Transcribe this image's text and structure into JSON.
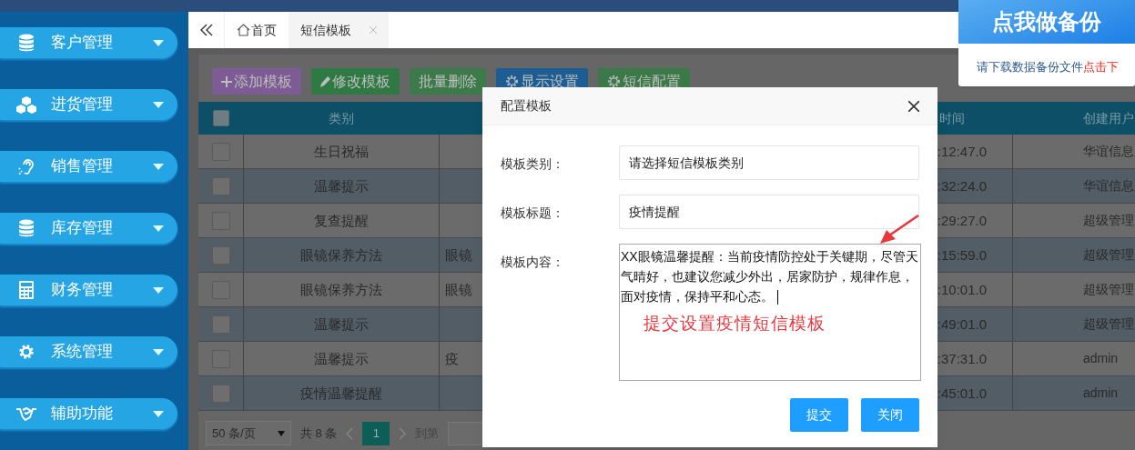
{
  "sidebar": {
    "items": [
      {
        "label": "客户管理"
      },
      {
        "label": "进货管理"
      },
      {
        "label": "销售管理"
      },
      {
        "label": "库存管理"
      },
      {
        "label": "财务管理"
      },
      {
        "label": "系统管理"
      },
      {
        "label": "辅助功能"
      }
    ]
  },
  "tabs": [
    {
      "label": "首页",
      "selected": false
    },
    {
      "label": "短信模板",
      "selected": true
    }
  ],
  "toolbar": [
    {
      "label": "添加模板",
      "color": "#7d5b94"
    },
    {
      "label": "修改模板",
      "color": "#2f7a44"
    },
    {
      "label": "批量删除",
      "color": "#3d7a4b"
    },
    {
      "label": "显示设置",
      "color": "#1c5e94"
    },
    {
      "label": "短信配置",
      "color": "#3b7a48"
    }
  ],
  "table": {
    "columns": [
      "类别",
      "时间",
      "创建用户"
    ],
    "all_checked": false,
    "rows": [
      {
        "checked": false,
        "category": "生日祝福",
        "time": ":12:47.0",
        "creator": "华谊信息"
      },
      {
        "checked": false,
        "category": "温馨提示",
        "time": ":32:24.0",
        "creator": "华谊信息"
      },
      {
        "checked": false,
        "category": "复查提醒",
        "time": ":29:27.0",
        "creator": "超级管理"
      },
      {
        "checked": false,
        "category": "眼镜保养方法",
        "column_3": "眼镜",
        "time": ":15:59.0",
        "creator": "超级管理"
      },
      {
        "checked": false,
        "category": "眼镜保养方法",
        "column_3": "眼镜",
        "time": ":10:01.0",
        "creator": "超级管理"
      },
      {
        "checked": false,
        "category": "温馨提示",
        "time": ":49:01.0",
        "creator": "超级管理"
      },
      {
        "checked": false,
        "category": "温馨提示",
        "column_3": "疫",
        "time": ":37:31.0",
        "creator": "admin"
      },
      {
        "checked": false,
        "category": "疫情温馨提醒",
        "time": ":45:01.0",
        "creator": "admin"
      }
    ]
  },
  "pagination": {
    "page_size": "50 条/页",
    "total": "共 8 条",
    "current_page": "1",
    "goto_label": "到第"
  },
  "dialog": {
    "title": "配置模板",
    "fields": [
      {
        "label": "模板类别：",
        "kind": "select",
        "value": "请选择短信模板类别"
      },
      {
        "label": "模板标题：",
        "kind": "input",
        "value": "疫情提醒"
      },
      {
        "label": "模板内容：",
        "kind": "textarea",
        "value": "XX眼镜温馨提醒：当前疫情防控处于关键期，尽管天气晴好，也建议您减少外出，居家防护，规律作息，面对疫情，保持平和心态。"
      }
    ],
    "annotation": "提交设置疫情短信模板",
    "buttons": [
      "提交",
      "关闭"
    ]
  },
  "backup_popup": {
    "banner": "点我做备份",
    "message": "请下载数据备份文件",
    "link": "点击下"
  }
}
